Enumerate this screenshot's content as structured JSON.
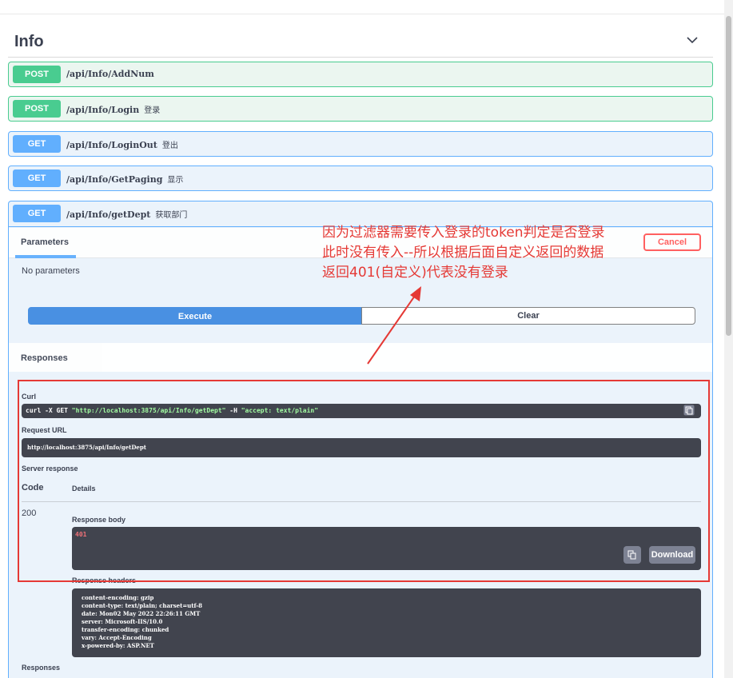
{
  "section": {
    "title": "Info"
  },
  "operations": [
    {
      "method": "POST",
      "path": "/api/Info/AddNum",
      "desc": ""
    },
    {
      "method": "POST",
      "path": "/api/Info/Login",
      "desc": "登录"
    },
    {
      "method": "GET",
      "path": "/api/Info/LoginOut",
      "desc": "登出"
    },
    {
      "method": "GET",
      "path": "/api/Info/GetPaging",
      "desc": "显示"
    },
    {
      "method": "GET",
      "path": "/api/Info/getDept",
      "desc": "获取部门"
    }
  ],
  "expanded": {
    "params_tab": "Parameters",
    "cancel_label": "Cancel",
    "no_params": "No parameters",
    "execute_label": "Execute",
    "clear_label": "Clear",
    "responses_title": "Responses",
    "curl_label": "Curl",
    "curl_cmd_prefix": "curl -X GET ",
    "curl_url": "\"http://localhost:3875/api/Info/getDept\"",
    "curl_mid": " -H  ",
    "curl_header": "\"accept: text/plain\"",
    "request_url_label": "Request URL",
    "request_url": "http://localhost:3875/api/Info/getDept",
    "server_response_label": "Server response",
    "code_col": "Code",
    "details_col": "Details",
    "status_code": "200",
    "response_body_label": "Response body",
    "response_body": "401",
    "download_label": "Download",
    "response_headers_label": "Response headers",
    "response_headers": [
      "content-encoding: gzip",
      "content-type: text/plain; charset=utf-8",
      "date: Mon02 May 2022 22:26:11 GMT",
      "server: Microsoft-IIS/10.0",
      "transfer-encoding: chunked",
      "vary: Accept-Encoding",
      "x-powered-by: ASP.NET"
    ],
    "responses_bottom": "Responses"
  },
  "annotation": {
    "lines": [
      "因为过滤器需要传入登录的token判定是否登录",
      "此时没有传入--所以根据后面自定义返回的数据",
      "返回401(自定义)代表没有登录"
    ],
    "color": "#e53935"
  },
  "colors": {
    "post": "#49cc90",
    "get": "#61affe",
    "execute": "#4990e2",
    "cancel": "#ff6060"
  }
}
